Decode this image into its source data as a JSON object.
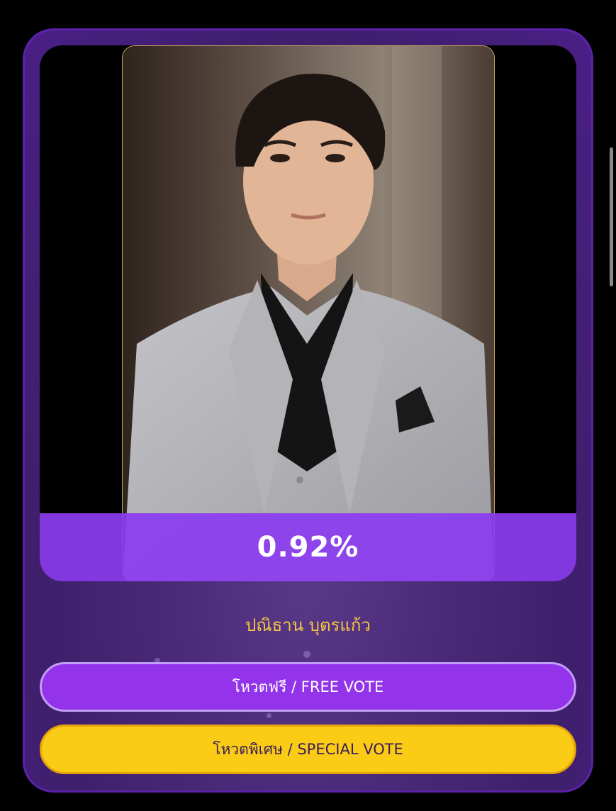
{
  "vote_card": {
    "percentage": "0.92%",
    "candidate_name": "ปณิธาน บุตรแก้ว",
    "free_vote_label": "โหวตฟรี / FREE VOTE",
    "special_vote_label": "โหวตพิเศษ / SPECIAL VOTE"
  },
  "colors": {
    "card_purple": "#4a2a78",
    "bar_purple": "#8c3cf0",
    "name_gold": "#f5c542",
    "free_button": "#9333ea",
    "special_button": "#facc15"
  }
}
